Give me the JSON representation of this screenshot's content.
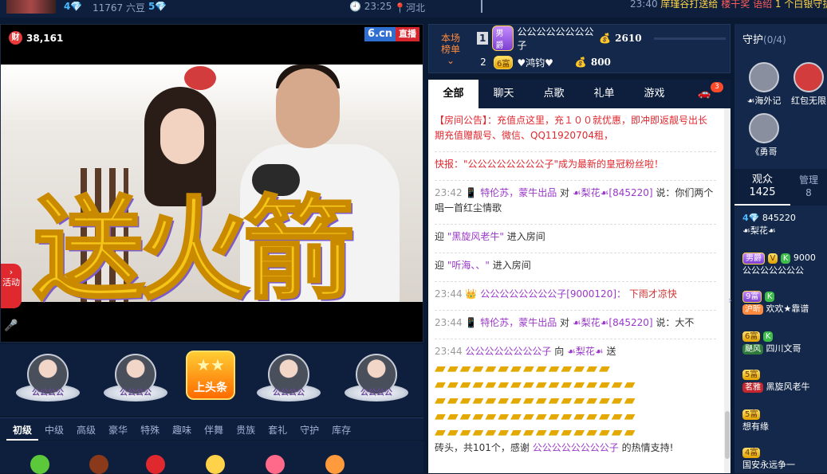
{
  "topbar": {
    "level_left": "4",
    "count_label": "11767 六豆",
    "level_right": "5",
    "time": "23:25",
    "location": "河北",
    "marquee_time": "23:40",
    "marquee_text": "庠瑾谷打送给",
    "marquee_highlight": "楼干奖 语绍",
    "marquee_tail": "1 个白银守护"
  },
  "video": {
    "wealth_icon": "财",
    "wealth_value": "38,161",
    "brand": "6.cn",
    "live": "直播",
    "overlay_text": "送火箭",
    "side_tab": "活动"
  },
  "gift_row": {
    "items": [
      {
        "label": "公公公公"
      },
      {
        "label": "公公公公"
      },
      {
        "label": "上头条"
      },
      {
        "label": "公公公公"
      },
      {
        "label": "公公公公"
      }
    ]
  },
  "gift_tabs": [
    "初级",
    "中级",
    "高级",
    "豪华",
    "特殊",
    "趣味",
    "伴舞",
    "贵族",
    "套礼",
    "守护",
    "库存"
  ],
  "rank": {
    "label_line1": "本场",
    "label_line2": "榜单",
    "rows": [
      {
        "n": "1",
        "badge": "男爵",
        "name": "公公公公公公公公子",
        "value": "2610"
      },
      {
        "n": "2",
        "badge": "6富",
        "name": "♥鸿钧♥",
        "value": "800"
      }
    ]
  },
  "chat": {
    "tabs": [
      "全部",
      "聊天",
      "点歌",
      "礼单",
      "游戏"
    ],
    "car_count": "3",
    "notice_tag": "【房间公告】：",
    "notice_text": "充值点这里，充１００就优惠，即冲即返靓号出长期充值赠靓号、微信、QQ11920704租，",
    "flash_tag": "快报：",
    "flash_text": "\"公公公公公公公公子\"成为最新的皇冠粉丝啦！",
    "m1_time": "23:42",
    "m1_user": "特伦苏，蒙牛出品",
    "m1_to": "对",
    "m1_target": "☙梨花☙[845220]",
    "m1_said": "说：你们两个唱一首红尘情歌",
    "m2_pre": "迎",
    "m2_name": "\"黑旋风老牛\"",
    "m2_post": "进入房间",
    "m3_pre": "迎",
    "m3_name": "\"听海、、\"",
    "m3_post": "进入房间",
    "m4_time": "23:44",
    "m4_user": "公公公公公公公公子[9000120]：",
    "m4_text": "下雨才凉快",
    "m5_time": "23:44",
    "m5_user": "特伦苏，蒙牛出品",
    "m5_to": "对",
    "m5_target": "☙梨花☙[845220]",
    "m5_said": "说：大不",
    "m6_time": "23:44",
    "m6_user": "公公公公公公公公子",
    "m6_to": "向",
    "m6_target": "☙梨花☙",
    "m6_verb": "送",
    "m7_pre": "砖头，共101个，感谢",
    "m7_user": "公公公公公公公公子",
    "m7_post": "的热情支持!"
  },
  "right": {
    "guard_title": "守护",
    "guard_count": "(0/4)",
    "guards": [
      {
        "name": "☙海外记"
      },
      {
        "name": "红包无限"
      },
      {
        "name": "《勇哥"
      }
    ],
    "audience_label": "观众",
    "audience_count": "1425",
    "manage_label": "管理",
    "manage_count": "8",
    "users": [
      {
        "level": "4",
        "id": "845220",
        "name": "☙梨花☙"
      },
      {
        "badge": "男爵",
        "id": "9000",
        "name": "公公公公公公公"
      },
      {
        "badge": "9富",
        "tag": "沪昕",
        "name": "欢欢★靠谱"
      },
      {
        "badge": "6富",
        "tag": "颶风",
        "name": "四川文哥"
      },
      {
        "badge": "5富",
        "tag": "茗雅",
        "name": "黑旋风老牛"
      },
      {
        "badge": "5富",
        "name": "想有缘"
      },
      {
        "badge": "4富",
        "name": "国安永远争一"
      }
    ]
  }
}
